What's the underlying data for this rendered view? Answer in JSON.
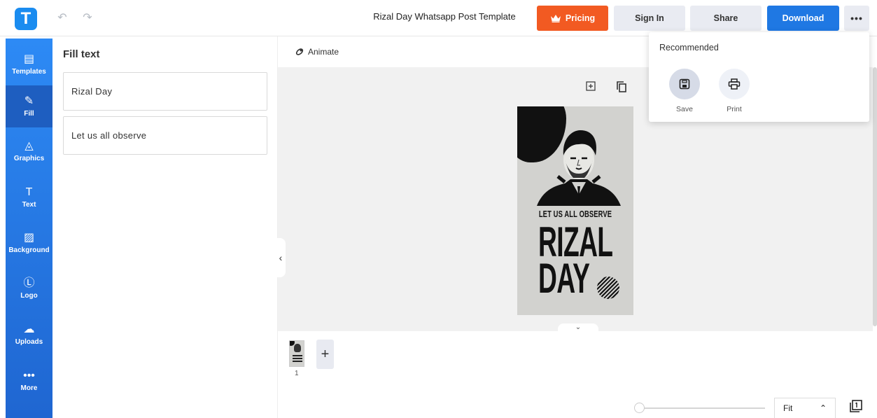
{
  "app": {
    "logo_letter": "T",
    "doc_title": "Rizal Day Whatsapp Post Template"
  },
  "toolbar": {
    "pricing": "Pricing",
    "sign_in": "Sign In",
    "share": "Share",
    "download": "Download",
    "more": "•••"
  },
  "rail": {
    "items": [
      {
        "label": "Templates",
        "icon": "templates-icon",
        "glyph": "▤"
      },
      {
        "label": "Fill",
        "icon": "pencil-icon",
        "glyph": "✎"
      },
      {
        "label": "Graphics",
        "icon": "shapes-icon",
        "glyph": "◬"
      },
      {
        "label": "Text",
        "icon": "text-icon",
        "glyph": "T"
      },
      {
        "label": "Background",
        "icon": "background-icon",
        "glyph": "▨"
      },
      {
        "label": "Logo",
        "icon": "logo-icon",
        "glyph": "Ⓛ"
      },
      {
        "label": "Uploads",
        "icon": "cloud-upload-icon",
        "glyph": "☁"
      },
      {
        "label": "More",
        "icon": "more-icon",
        "glyph": "•••"
      }
    ]
  },
  "panel": {
    "title": "Fill text",
    "fields": [
      "Rizal Day",
      "Let us all observe"
    ]
  },
  "workspace": {
    "animate": "Animate",
    "page_number": "1",
    "zoom": "Fit"
  },
  "poster": {
    "subtitle": "LET US ALL OBSERVE",
    "title_line1": "RIZAL",
    "title_line2": "DAY"
  },
  "dropdown": {
    "title": "Recommended",
    "save": "Save",
    "print": "Print"
  },
  "colors": {
    "brand": "#1a8cf0",
    "pricing": "#f25a22",
    "download": "#1f78e3",
    "rail": "#2d8af5"
  }
}
